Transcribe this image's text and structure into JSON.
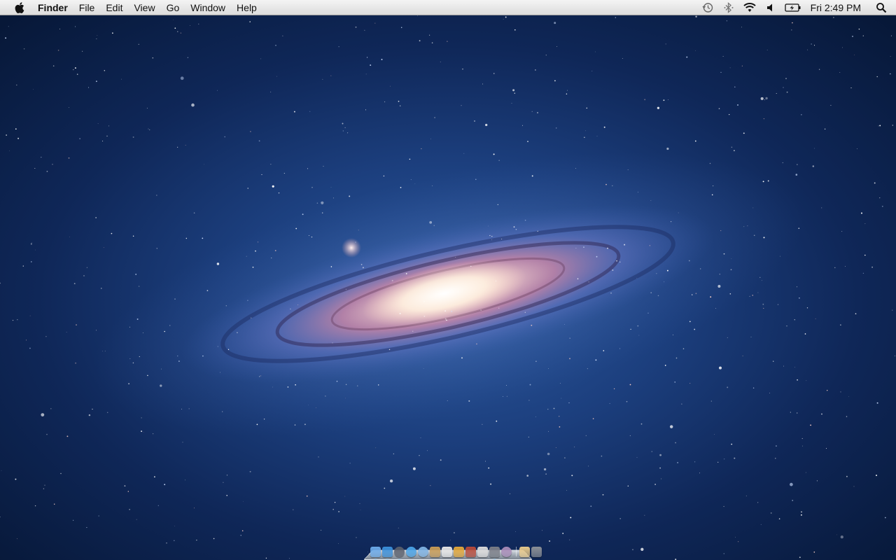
{
  "menubar": {
    "apple_icon": "apple-logo-icon",
    "app_name": "Finder",
    "menus": [
      "File",
      "Edit",
      "View",
      "Go",
      "Window",
      "Help"
    ],
    "status_icons": [
      "time-machine-icon",
      "bluetooth-icon",
      "wifi-icon",
      "volume-icon",
      "battery-charging-icon"
    ],
    "clock": "Fri 2:49 PM",
    "spotlight_icon": "spotlight-search-icon"
  },
  "wallpaper": {
    "subject": "galaxy",
    "colors": {
      "space_center": "#2d5aa0",
      "space_edge": "#071838",
      "core": "#fff5e6",
      "arms": "#d88aa8"
    }
  },
  "dock": {
    "apps": [
      {
        "icon": "finder-icon",
        "color": "#6aa9e8",
        "running": true
      },
      {
        "icon": "app-store-icon",
        "color": "#3b8fd9",
        "running": true
      },
      {
        "icon": "dashboard-icon",
        "color": "#5a5f6b",
        "running": true
      },
      {
        "icon": "safari-icon",
        "color": "#4aa3e6",
        "running": false
      },
      {
        "icon": "mail-icon",
        "color": "#7fb3e3",
        "running": false
      },
      {
        "icon": "address-book-icon",
        "color": "#c79b55",
        "running": false
      },
      {
        "icon": "ical-icon",
        "color": "#e4e4e4",
        "running": false
      },
      {
        "icon": "iphoto-icon",
        "color": "#e0a63a",
        "running": false
      },
      {
        "icon": "photo-booth-icon",
        "color": "#b74a3a",
        "running": false
      },
      {
        "icon": "preview-icon",
        "color": "#d9d9d9",
        "running": false
      },
      {
        "icon": "system-preferences-icon",
        "color": "#7a7d86",
        "running": true
      },
      {
        "icon": "itunes-icon",
        "color": "#a88bb7",
        "running": false
      }
    ],
    "stacks": [
      {
        "icon": "documents-stack-icon",
        "color": "#e6c88a"
      },
      {
        "icon": "trash-icon",
        "color": "#8c9096"
      }
    ]
  }
}
